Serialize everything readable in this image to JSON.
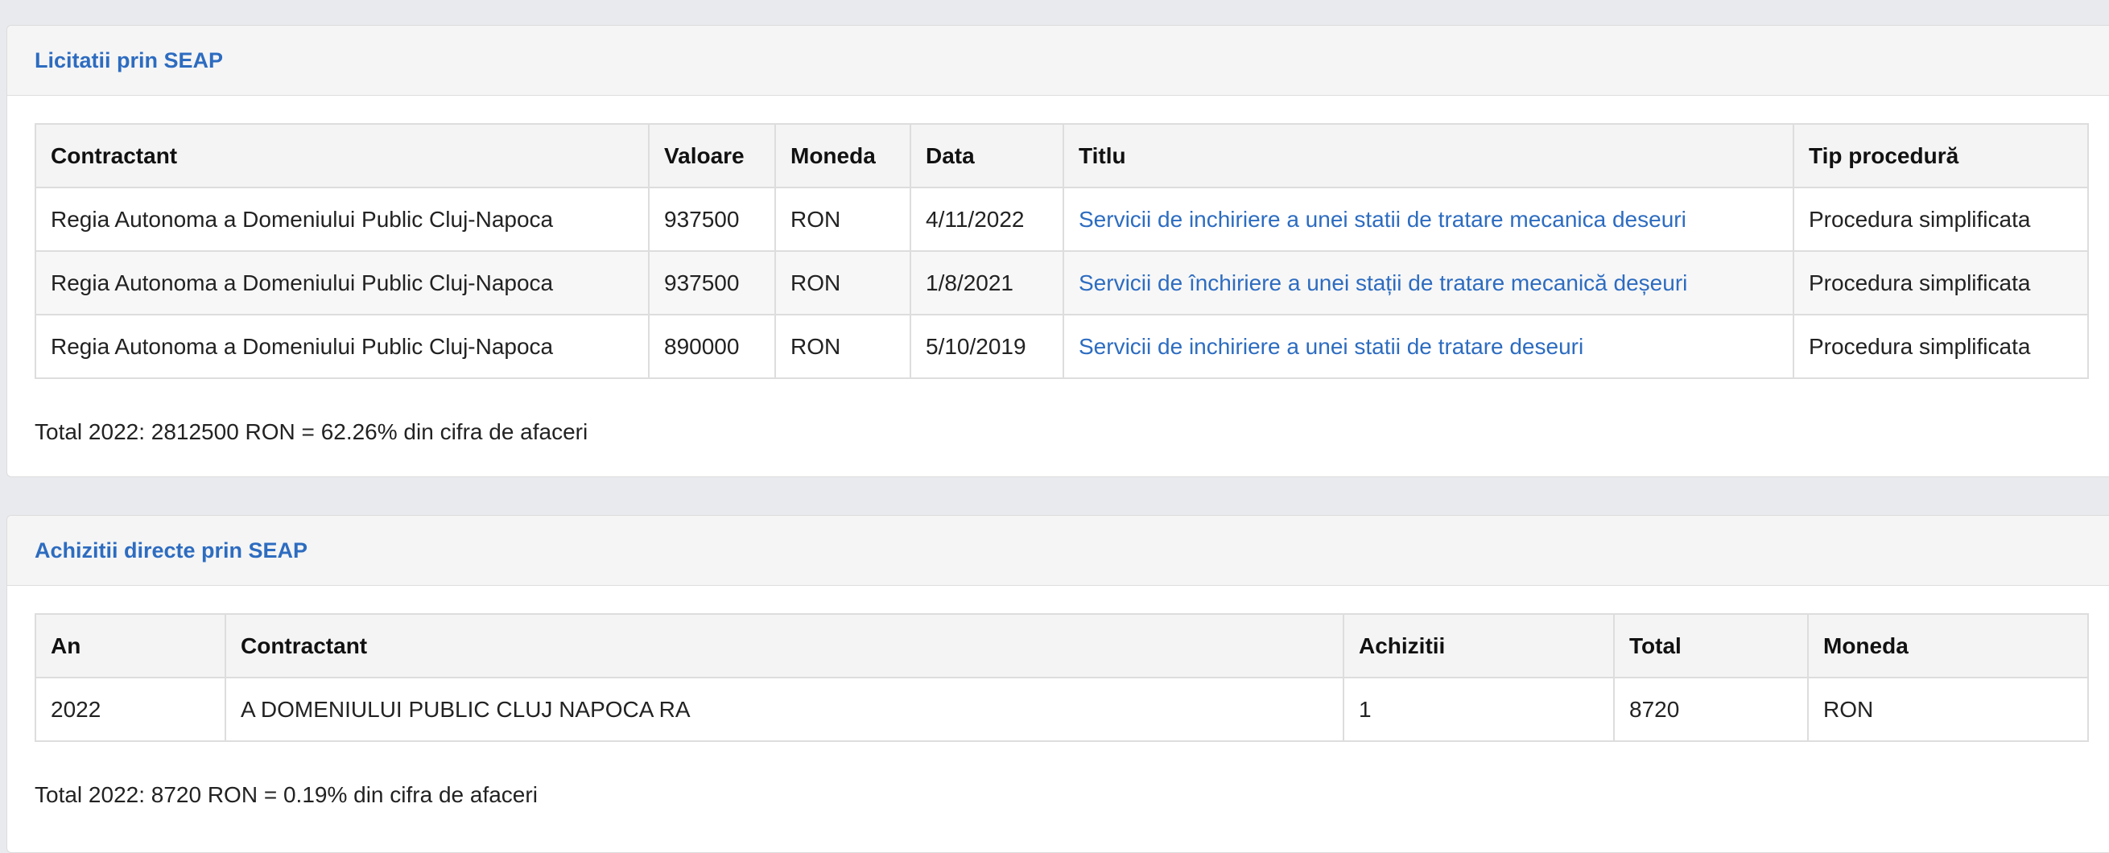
{
  "licitatii": {
    "title": "Licitatii prin SEAP",
    "columns": [
      "Contractant",
      "Valoare",
      "Moneda",
      "Data",
      "Titlu",
      "Tip procedură"
    ],
    "rows": [
      {
        "contractant": "Regia Autonoma a Domeniului Public Cluj-Napoca",
        "valoare": "937500",
        "moneda": "RON",
        "data": "4/11/2022",
        "titlu": "Servicii de inchiriere a unei statii de tratare mecanica deseuri",
        "tip": "Procedura simplificata"
      },
      {
        "contractant": "Regia Autonoma a Domeniului Public Cluj-Napoca",
        "valoare": "937500",
        "moneda": "RON",
        "data": "1/8/2021",
        "titlu": "Servicii de închiriere a unei stații de tratare mecanică deșeuri",
        "tip": "Procedura simplificata"
      },
      {
        "contractant": "Regia Autonoma a Domeniului Public Cluj-Napoca",
        "valoare": "890000",
        "moneda": "RON",
        "data": "5/10/2019",
        "titlu": "Servicii de inchiriere a unei statii de tratare deseuri",
        "tip": "Procedura simplificata"
      }
    ],
    "total": "Total 2022: 2812500 RON = 62.26% din cifra de afaceri"
  },
  "achizitii": {
    "title": "Achizitii directe prin SEAP",
    "columns": [
      "An",
      "Contractant",
      "Achizitii",
      "Total",
      "Moneda"
    ],
    "rows": [
      {
        "an": "2022",
        "contractant": "A DOMENIULUI PUBLIC CLUJ NAPOCA RA",
        "achizitii": "1",
        "total": "8720",
        "moneda": "RON"
      }
    ],
    "total": "Total 2022: 8720 RON = 0.19% din cifra de afaceri"
  },
  "colors": {
    "link": "#2d6cc0",
    "header_bg": "#f5f5f5",
    "page_bg": "#e9eaee"
  }
}
